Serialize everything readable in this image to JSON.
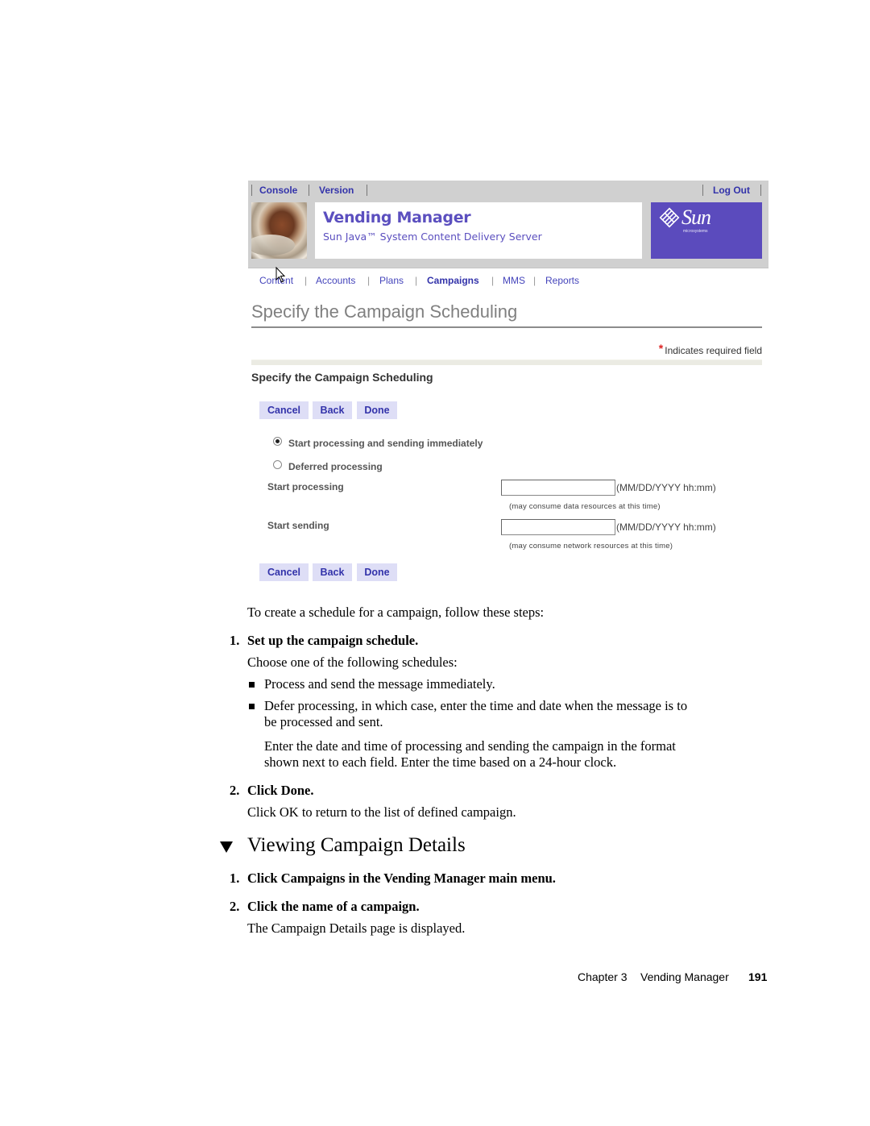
{
  "screenshot": {
    "topnav": {
      "console": "Console",
      "version": "Version",
      "logout": "Log Out"
    },
    "branding": {
      "app_title": "Vending Manager",
      "app_subtitle": "Sun Java™ System Content Delivery Server",
      "logo_word": "Sun",
      "logo_sub": "microsystems",
      "brand_color": "#5b4bbd"
    },
    "mainnav": {
      "items": [
        {
          "label": "Content",
          "active": false
        },
        {
          "label": "Accounts",
          "active": false
        },
        {
          "label": "Plans",
          "active": false
        },
        {
          "label": "Campaigns",
          "active": true
        },
        {
          "label": "MMS",
          "active": false
        },
        {
          "label": "Reports",
          "active": false
        }
      ],
      "separator": "|"
    },
    "page_title": "Specify the Campaign Scheduling",
    "required_note": {
      "star": "*",
      "text": "Indicates required field"
    },
    "section_title": "Specify the Campaign Scheduling",
    "buttons": {
      "cancel": "Cancel",
      "back": "Back",
      "done": "Done"
    },
    "options": {
      "immediate": {
        "label": "Start processing and sending immediately",
        "checked": true
      },
      "deferred": {
        "label": "Deferred processing",
        "checked": false
      }
    },
    "fields": {
      "start_processing": {
        "label": "Start processing",
        "value": "",
        "format": "(MM/DD/YYYY hh:mm)",
        "hint": "(may consume data resources at this time)"
      },
      "start_sending": {
        "label": "Start sending",
        "value": "",
        "format": "(MM/DD/YYYY hh:mm)",
        "hint": "(may consume network resources at this time)"
      }
    }
  },
  "document": {
    "intro": "To create a schedule for a campaign, follow these steps:",
    "steps_schedule": [
      {
        "num": "1.",
        "title": "Set up the campaign schedule."
      },
      {
        "num": "2.",
        "title": "Click Done."
      }
    ],
    "choose": "Choose one of the following schedules:",
    "bullets": [
      "Process and send the message immediately.",
      "Defer processing, in which case, enter the time and date when the message is to",
      "be processed and sent."
    ],
    "enter_line1": "Enter the date and time of processing and sending the campaign in the format",
    "enter_line2": "shown next to each field. Enter the time based on a 24-hour clock.",
    "click_ok": "Click OK to return to the list of defined campaign.",
    "section_heading": "Viewing Campaign Details",
    "steps_view": [
      {
        "num": "1.",
        "title": "Click Campaigns in the Vending Manager main menu."
      },
      {
        "num": "2.",
        "title": "Click the name of a campaign."
      }
    ],
    "view_result": "The Campaign Details page is displayed."
  },
  "footer": {
    "chapter": "Chapter 3",
    "chapter_title": "Vending Manager",
    "page_number": "191"
  }
}
